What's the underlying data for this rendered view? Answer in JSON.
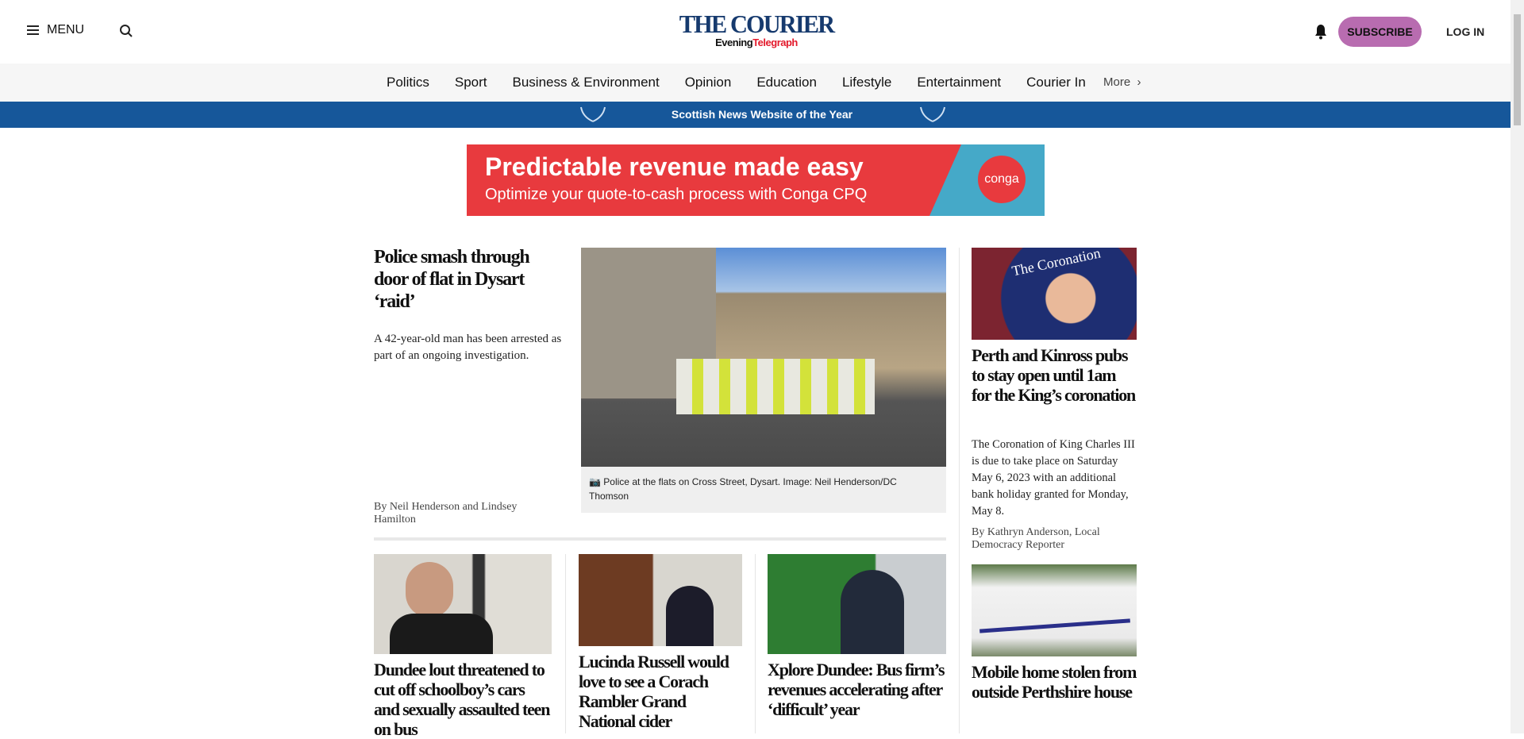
{
  "header": {
    "menu_label": "MENU",
    "logo_main": "THE COURIER",
    "logo_sub_1": "Evening",
    "logo_sub_2": "Telegraph",
    "subscribe_label": "SUBSCRIBE",
    "login_label": "LOG IN"
  },
  "nav": {
    "items": [
      "Politics",
      "Sport",
      "Business & Environment",
      "Opinion",
      "Education",
      "Lifestyle",
      "Entertainment",
      "Courier In"
    ],
    "more_label": "More"
  },
  "banner": {
    "text": "Scottish News Website of the Year",
    "color": "#16579a"
  },
  "ad": {
    "headline": "Predictable revenue made easy",
    "subline": "Optimize your quote-to-cash process with Conga CPQ",
    "brand": "conga"
  },
  "lead": {
    "headline": "Police smash through door of flat in Dysart ‘raid’",
    "summary": "A 42-year-old man has been arrested as part of an ongoing investigation.",
    "byline": "By Neil Henderson and Lindsey Hamilton",
    "caption": "Police at the flats on Cross Street, Dysart. Image: Neil Henderson/DC Thomson"
  },
  "side": [
    {
      "headline": "Perth and Kinross pubs to stay open until 1am for the King’s coronation",
      "summary": "The Coronation of King Charles III is due to take place on Saturday May 6, 2023 with an additional bank holiday granted for Monday, May 8.",
      "byline": "By Kathryn Anderson, Local Democracy Reporter",
      "image_text": "The Coronation"
    },
    {
      "headline": "Mobile home stolen from outside Perthshire house"
    }
  ],
  "cards": [
    {
      "headline": "Dundee lout threatened to cut off schoolboy’s cars and sexually assaulted teen on bus"
    },
    {
      "headline": "Lucinda Russell would love to see a Corach Rambler Grand National cider"
    },
    {
      "headline": "Xplore Dundee: Bus firm’s revenues accelerating after ‘difficult’ year"
    }
  ],
  "colors": {
    "subscribe": "#b86cb0",
    "logo": "#163a6e",
    "ad": "#e83a3e"
  }
}
